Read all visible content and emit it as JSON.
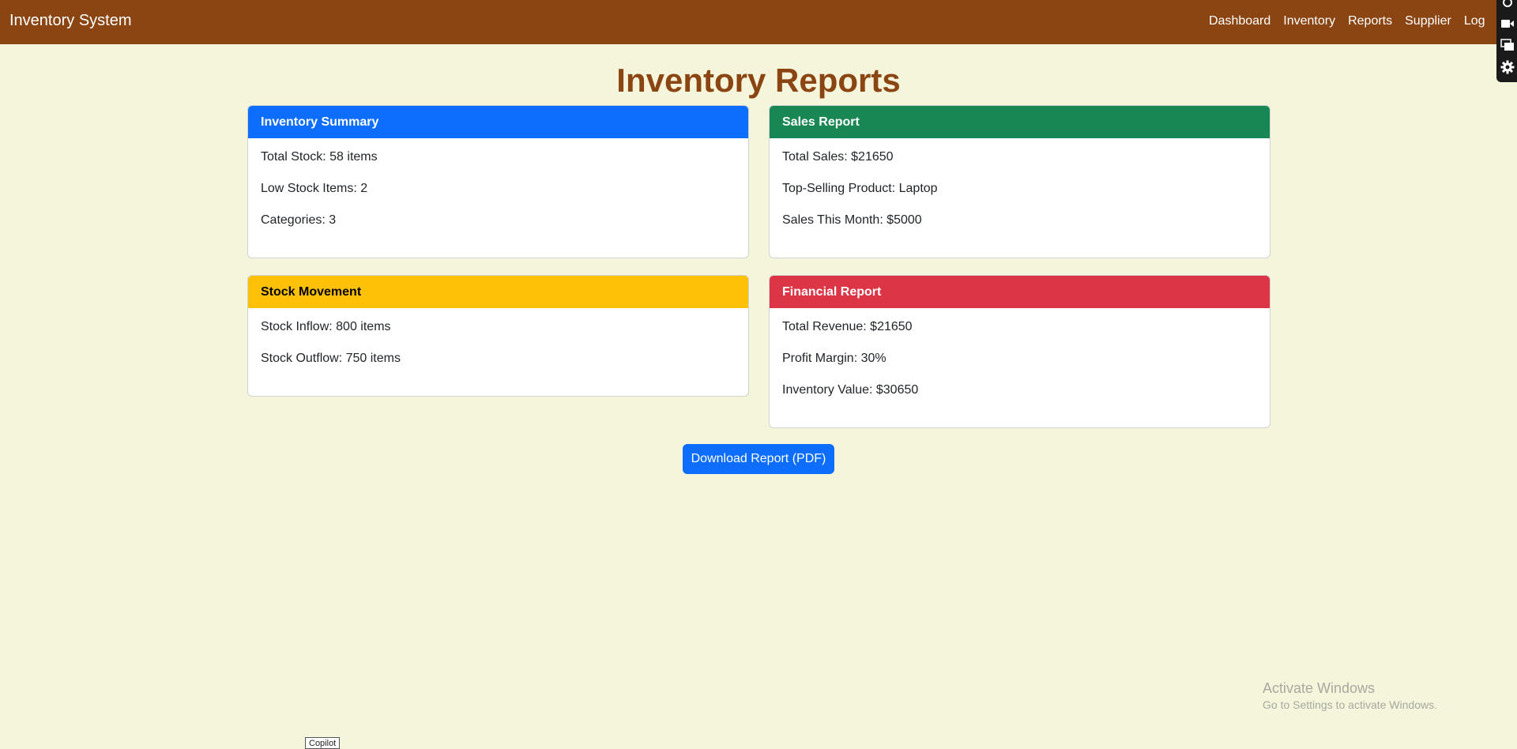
{
  "navbar": {
    "brand": "Inventory System",
    "color": "#8b4513",
    "links": [
      "Dashboard",
      "Inventory",
      "Reports",
      "Supplier",
      "Logout"
    ]
  },
  "side_toolbar": {
    "icons": [
      "record-icon",
      "video-camera-icon",
      "stacked-windows-icon",
      "gear-icon"
    ]
  },
  "page": {
    "title": "Inventory Reports",
    "background": "#f5f5dc",
    "title_color": "#8b4513"
  },
  "cards": {
    "inventory_summary": {
      "title": "Inventory Summary",
      "header_color": "#0d6efd",
      "lines": [
        "Total Stock: 58 items",
        "Low Stock Items: 2",
        "Categories: 3"
      ]
    },
    "sales_report": {
      "title": "Sales Report",
      "header_color": "#198754",
      "lines": [
        "Total Sales: $21650",
        "Top-Selling Product: Laptop",
        "Sales This Month: $5000"
      ]
    },
    "stock_movement": {
      "title": "Stock Movement",
      "header_color": "#ffc107",
      "lines": [
        "Stock Inflow: 800 items",
        "Stock Outflow: 750 items"
      ]
    },
    "financial_report": {
      "title": "Financial Report",
      "header_color": "#dc3545",
      "lines": [
        "Total Revenue: $21650",
        "Profit Margin: 30%",
        "Inventory Value: $30650"
      ]
    }
  },
  "actions": {
    "download_label": "Download Report (PDF)"
  },
  "watermark": {
    "title": "Activate Windows",
    "subtitle": "Go to Settings to activate Windows."
  },
  "copilot_tag": "Copilot"
}
